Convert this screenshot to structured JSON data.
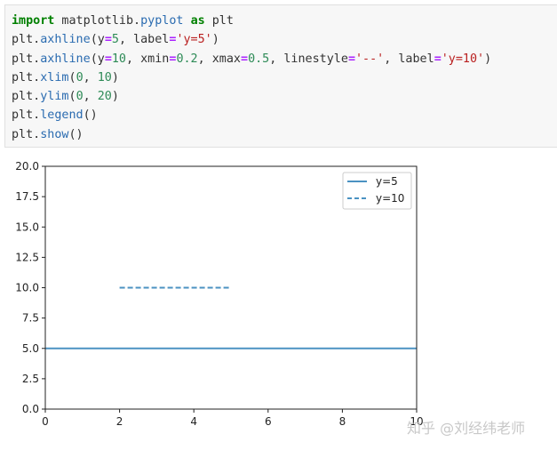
{
  "code_cell": {
    "lines": [
      [
        {
          "t": "import",
          "c": "kw"
        },
        {
          "t": " matplotlib.",
          "c": ""
        },
        {
          "t": "pyplot",
          "c": "fn"
        },
        {
          "t": " ",
          "c": ""
        },
        {
          "t": "as",
          "c": "kw"
        },
        {
          "t": " plt",
          "c": ""
        }
      ],
      [
        {
          "t": "plt.",
          "c": ""
        },
        {
          "t": "axhline",
          "c": "fn"
        },
        {
          "t": "(y",
          "c": ""
        },
        {
          "t": "=",
          "c": "op"
        },
        {
          "t": "5",
          "c": "num"
        },
        {
          "t": ", label",
          "c": ""
        },
        {
          "t": "=",
          "c": "op"
        },
        {
          "t": "'y=5'",
          "c": "str"
        },
        {
          "t": ")",
          "c": ""
        }
      ],
      [
        {
          "t": "plt.",
          "c": ""
        },
        {
          "t": "axhline",
          "c": "fn"
        },
        {
          "t": "(y",
          "c": ""
        },
        {
          "t": "=",
          "c": "op"
        },
        {
          "t": "10",
          "c": "num"
        },
        {
          "t": ", xmin",
          "c": ""
        },
        {
          "t": "=",
          "c": "op"
        },
        {
          "t": "0.2",
          "c": "num"
        },
        {
          "t": ", xmax",
          "c": ""
        },
        {
          "t": "=",
          "c": "op"
        },
        {
          "t": "0.5",
          "c": "num"
        },
        {
          "t": ", linestyle",
          "c": ""
        },
        {
          "t": "=",
          "c": "op"
        },
        {
          "t": "'--'",
          "c": "str"
        },
        {
          "t": ", label",
          "c": ""
        },
        {
          "t": "=",
          "c": "op"
        },
        {
          "t": "'y=10'",
          "c": "str"
        },
        {
          "t": ")",
          "c": ""
        }
      ],
      [
        {
          "t": "plt.",
          "c": ""
        },
        {
          "t": "xlim",
          "c": "fn"
        },
        {
          "t": "(",
          "c": ""
        },
        {
          "t": "0",
          "c": "num"
        },
        {
          "t": ", ",
          "c": ""
        },
        {
          "t": "10",
          "c": "num"
        },
        {
          "t": ")",
          "c": ""
        }
      ],
      [
        {
          "t": "plt.",
          "c": ""
        },
        {
          "t": "ylim",
          "c": "fn"
        },
        {
          "t": "(",
          "c": ""
        },
        {
          "t": "0",
          "c": "num"
        },
        {
          "t": ", ",
          "c": ""
        },
        {
          "t": "20",
          "c": "num"
        },
        {
          "t": ")",
          "c": ""
        }
      ],
      [
        {
          "t": "plt.",
          "c": ""
        },
        {
          "t": "legend",
          "c": "fn"
        },
        {
          "t": "()",
          "c": ""
        }
      ],
      [
        {
          "t": "plt.",
          "c": ""
        },
        {
          "t": "show",
          "c": "fn"
        },
        {
          "t": "()",
          "c": ""
        }
      ]
    ]
  },
  "chart_data": {
    "type": "line",
    "title": "",
    "xlabel": "",
    "ylabel": "",
    "xlim": [
      0,
      10
    ],
    "ylim": [
      0,
      20
    ],
    "xticks": [
      "0",
      "2",
      "4",
      "6",
      "8",
      "10"
    ],
    "yticks": [
      "0.0",
      "2.5",
      "5.0",
      "7.5",
      "10.0",
      "12.5",
      "15.0",
      "17.5",
      "20.0"
    ],
    "grid": false,
    "legend_position": "top-right",
    "series": [
      {
        "name": "y=5",
        "y": 5,
        "x": [
          0,
          10
        ],
        "linestyle": "solid",
        "color": "#1f77b4"
      },
      {
        "name": "y=10",
        "y": 10,
        "x": [
          2,
          5
        ],
        "linestyle": "dashed",
        "color": "#1f77b4"
      }
    ]
  },
  "watermark": "知乎 @刘经纬老师"
}
